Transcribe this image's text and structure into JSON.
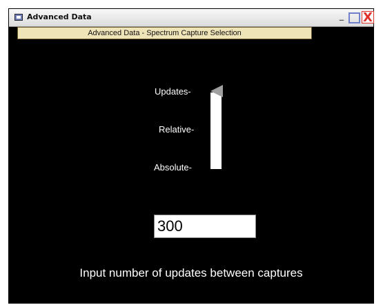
{
  "window": {
    "title": "Advanced Data",
    "minimize_label": "_",
    "maximize_label": "",
    "close_label": "X"
  },
  "header": {
    "subtitle": "Advanced Data - Spectrum Capture Selection"
  },
  "slider": {
    "labels": [
      "Updates-",
      "Relative-",
      "Absolute-"
    ],
    "options": [
      "Updates",
      "Relative",
      "Absolute"
    ],
    "selected": "Updates"
  },
  "input": {
    "value": "300"
  },
  "hint": "Input number of updates between captures"
}
